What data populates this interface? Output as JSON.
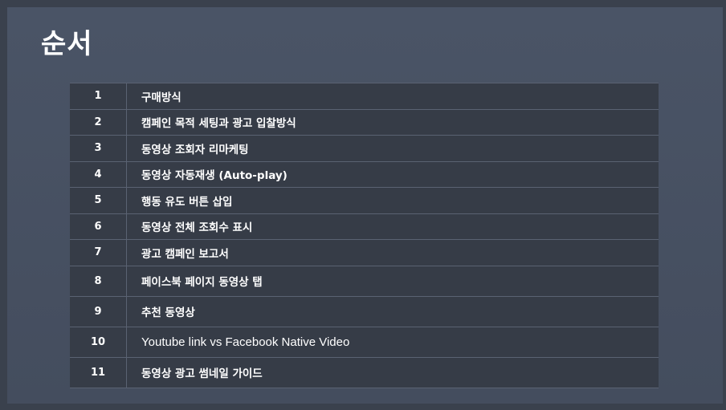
{
  "title": "순서",
  "toc": [
    {
      "num": "1",
      "label": "구매방식"
    },
    {
      "num": "2",
      "label": "캠페인 목적 세팅과 광고 입찰방식"
    },
    {
      "num": "3",
      "label": "동영상 조회자 리마케팅"
    },
    {
      "num": "4",
      "label": "동영상 자동재생 (Auto-play)"
    },
    {
      "num": "5",
      "label": "행동 유도 버튼 삽입"
    },
    {
      "num": "6",
      "label": "동영상 전체 조회수 표시"
    },
    {
      "num": "7",
      "label": "광고 캠페인 보고서"
    },
    {
      "num": "8",
      "label": "페이스북 페이지 동영상 탭"
    },
    {
      "num": "9",
      "label": "추천 동영상"
    },
    {
      "num": "10",
      "label": "Youtube link vs Facebook Native Video"
    },
    {
      "num": "11",
      "label": "동영상 광고 썸네일 가이드"
    }
  ]
}
